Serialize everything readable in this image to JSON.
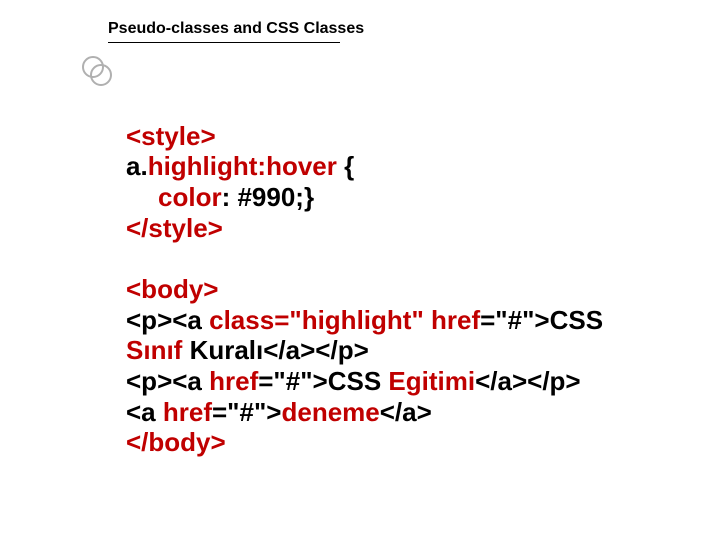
{
  "title": "Pseudo-classes and CSS Classes",
  "code": {
    "l1": "<style>",
    "l2a": "a.",
    "l2b": "highlight:hover",
    "l2c": " {",
    "l3a": "color",
    "l3b": ": #990;}",
    "l4": "</style>",
    "l5": "<body>",
    "l6a": "<p><a ",
    "l6b": "class=\"highlight\" ",
    "l6c": "href",
    "l6d": "=\"#\">CSS ",
    "l7a": "Sınıf",
    "l7b": " Kuralı</a></p>",
    "l8a": "<p><a ",
    "l8b": "href",
    "l8c": "=\"#\">CSS ",
    "l8d": "Egitimi",
    "l8e": "</a></p>",
    "l9a": "<a ",
    "l9b": "href",
    "l9c": "=\"#\">",
    "l9d": "deneme",
    "l9e": "</a>",
    "l10": "</body>"
  }
}
